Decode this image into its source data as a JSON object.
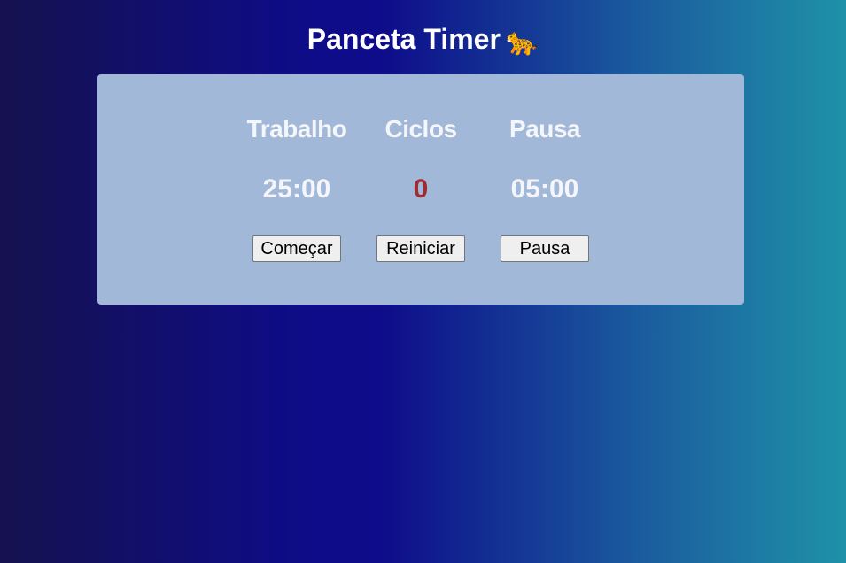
{
  "page": {
    "title": "Panceta Timer",
    "title_icon": "🐆"
  },
  "colors": {
    "panel_background": "#a1b8d8",
    "cycles_value": "#a12a33",
    "gradient_start": "#15124f",
    "gradient_mid": "#0e0c87",
    "gradient_end": "#1f92a8"
  },
  "timer": {
    "work": {
      "label": "Trabalho",
      "value": "25:00",
      "button_label": "Começar"
    },
    "cycles": {
      "label": "Ciclos",
      "value": "0",
      "button_label": "Reiniciar"
    },
    "pause": {
      "label": "Pausa",
      "value": "05:00",
      "button_label": "Pausa"
    }
  }
}
